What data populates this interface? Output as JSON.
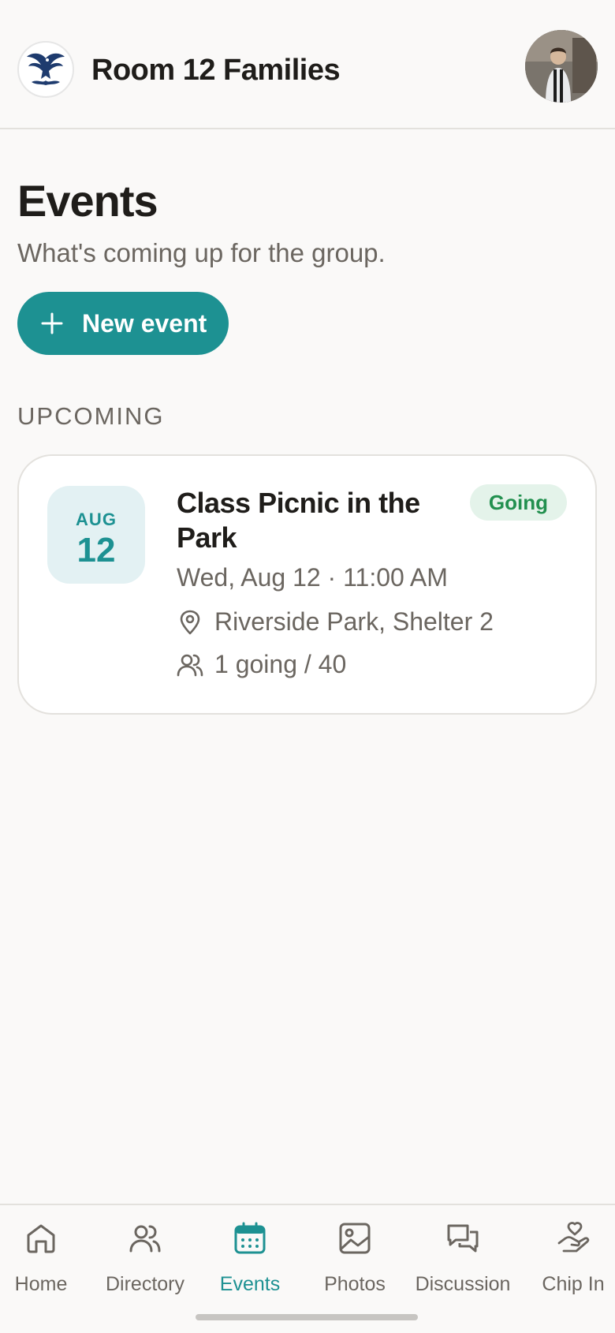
{
  "header": {
    "app_title": "Room 12 Families",
    "logo_icon": "eagle-logo-icon",
    "avatar_icon": "user-avatar"
  },
  "page": {
    "title": "Events",
    "subtitle": "What's coming up for the group.",
    "new_event_label": "New event"
  },
  "section": {
    "upcoming_label": "UPCOMING"
  },
  "events": [
    {
      "month": "AUG",
      "day": "12",
      "title": "Class Picnic in the Park",
      "status": "Going",
      "when": "Wed, Aug 12 · 11:00 AM",
      "location": "Riverside Park, Shelter 2",
      "attendance": "1 going / 40"
    }
  ],
  "tabs": [
    {
      "label": "Home",
      "icon": "home-icon",
      "active": false
    },
    {
      "label": "Directory",
      "icon": "people-icon",
      "active": false
    },
    {
      "label": "Events",
      "icon": "calendar-icon",
      "active": true
    },
    {
      "label": "Photos",
      "icon": "image-icon",
      "active": false
    },
    {
      "label": "Discussion",
      "icon": "chat-icon",
      "active": false
    },
    {
      "label": "Chip In",
      "icon": "hand-heart-icon",
      "active": false
    }
  ],
  "colors": {
    "accent": "#1d9192",
    "badge_bg": "#e4f3ea",
    "badge_text": "#22904f",
    "date_bg": "#e3f1f3",
    "background": "#faf9f8"
  }
}
